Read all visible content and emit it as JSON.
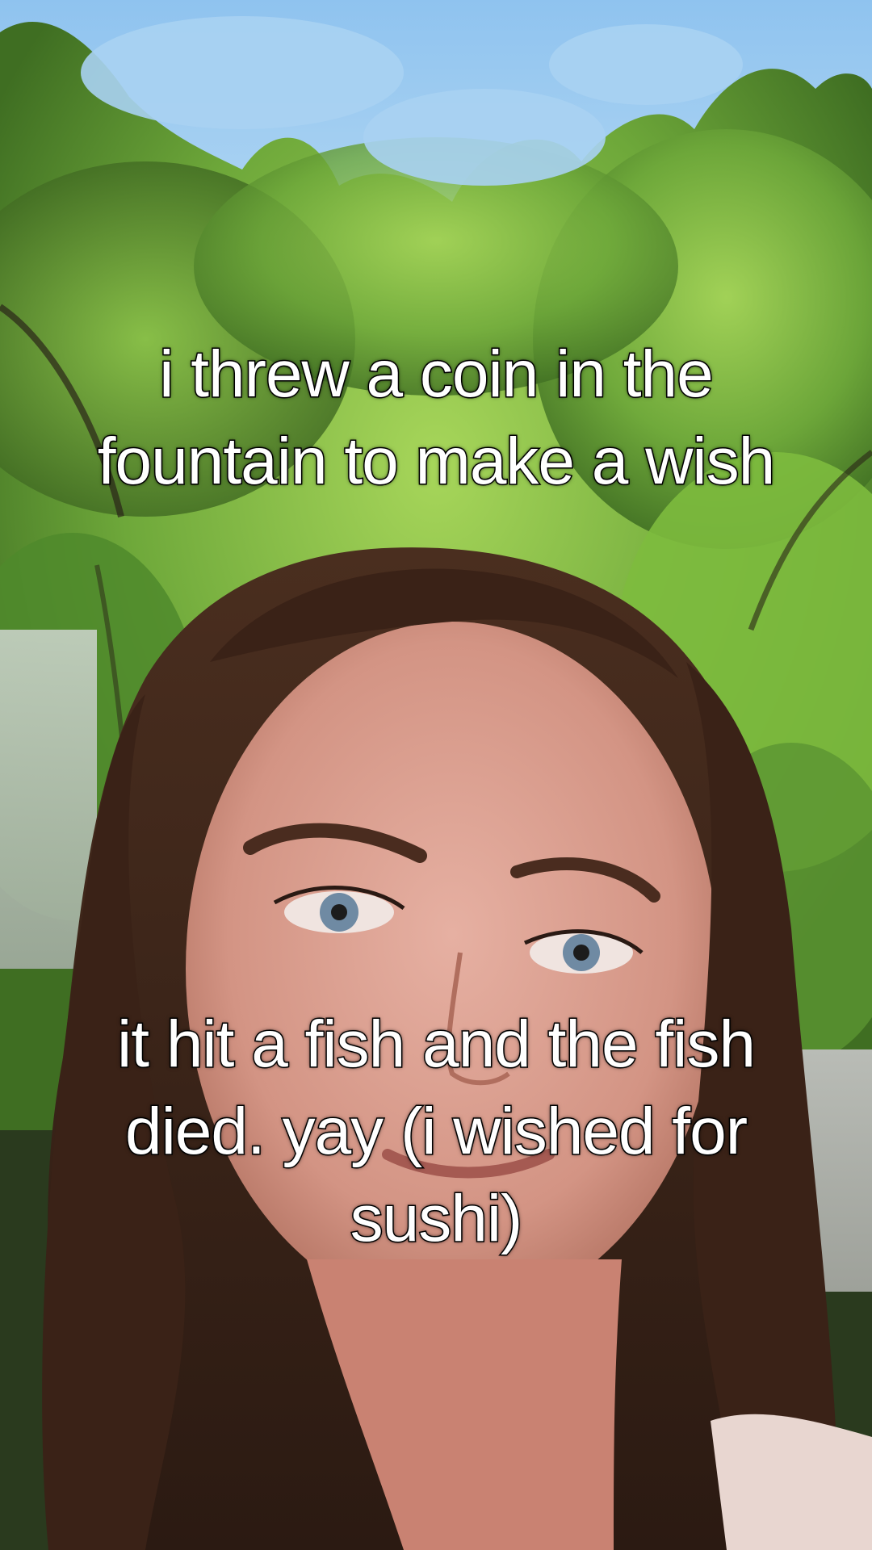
{
  "captions": {
    "top": "i threw a coin in the fountain to make a wish",
    "bottom": "it hit a fish and the fish died. yay (i wished for sushi)"
  },
  "colors": {
    "sky": "#a9d2f2",
    "foliage": "#6ea83a",
    "hair": "#3b2418",
    "skin": "#d9a395",
    "caption_text": "#ffffff",
    "caption_outline": "#000000"
  }
}
